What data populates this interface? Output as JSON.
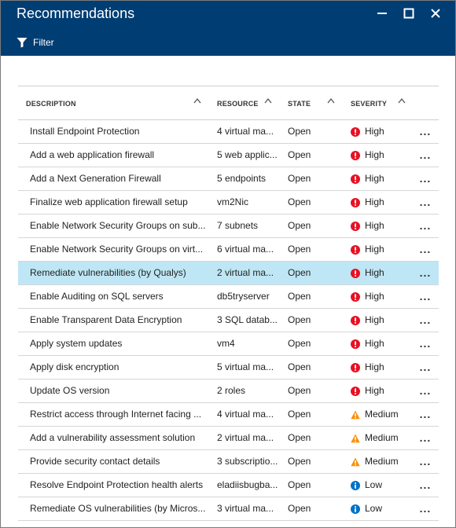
{
  "window": {
    "title": "Recommendations",
    "filter_label": "Filter"
  },
  "columns": {
    "description": "DESCRIPTION",
    "resource": "RESOURCE",
    "state": "STATE",
    "severity": "SEVERITY"
  },
  "colors": {
    "header_bg": "#003d73",
    "selected_row": "#bfe6f5",
    "high": "#e81123",
    "medium": "#ff8c00",
    "low": "#0072c6"
  },
  "rows": [
    {
      "description": "Install Endpoint Protection",
      "resource": "4 virtual ma...",
      "state": "Open",
      "severity": "High",
      "more": "...",
      "selected": false
    },
    {
      "description": "Add a web application firewall",
      "resource": "5 web applic...",
      "state": "Open",
      "severity": "High",
      "more": "...",
      "selected": false
    },
    {
      "description": "Add a Next Generation Firewall",
      "resource": "5 endpoints",
      "state": "Open",
      "severity": "High",
      "more": "...",
      "selected": false
    },
    {
      "description": "Finalize web application firewall setup",
      "resource": "vm2Nic",
      "state": "Open",
      "severity": "High",
      "more": "...",
      "selected": false
    },
    {
      "description": "Enable Network Security Groups on sub...",
      "resource": "7 subnets",
      "state": "Open",
      "severity": "High",
      "more": "...",
      "selected": false
    },
    {
      "description": "Enable Network Security Groups on virt...",
      "resource": "6 virtual ma...",
      "state": "Open",
      "severity": "High",
      "more": "...",
      "selected": false
    },
    {
      "description": "Remediate vulnerabilities (by Qualys)",
      "resource": "2 virtual ma...",
      "state": "Open",
      "severity": "High",
      "more": "...",
      "selected": true
    },
    {
      "description": "Enable Auditing on SQL servers",
      "resource": "db5tryserver",
      "state": "Open",
      "severity": "High",
      "more": "...",
      "selected": false
    },
    {
      "description": "Enable Transparent Data Encryption",
      "resource": "3 SQL datab...",
      "state": "Open",
      "severity": "High",
      "more": "...",
      "selected": false
    },
    {
      "description": "Apply system updates",
      "resource": "vm4",
      "state": "Open",
      "severity": "High",
      "more": "...",
      "selected": false
    },
    {
      "description": "Apply disk encryption",
      "resource": "5 virtual ma...",
      "state": "Open",
      "severity": "High",
      "more": "...",
      "selected": false
    },
    {
      "description": "Update OS version",
      "resource": "2 roles",
      "state": "Open",
      "severity": "High",
      "more": "...",
      "selected": false
    },
    {
      "description": "Restrict access through Internet facing ...",
      "resource": "4 virtual ma...",
      "state": "Open",
      "severity": "Medium",
      "more": "...",
      "selected": false
    },
    {
      "description": "Add a vulnerability assessment solution",
      "resource": "2 virtual ma...",
      "state": "Open",
      "severity": "Medium",
      "more": "...",
      "selected": false
    },
    {
      "description": "Provide security contact details",
      "resource": "3 subscriptio...",
      "state": "Open",
      "severity": "Medium",
      "more": "...",
      "selected": false
    },
    {
      "description": "Resolve Endpoint Protection health alerts",
      "resource": "eladiisbugba...",
      "state": "Open",
      "severity": "Low",
      "more": "...",
      "selected": false
    },
    {
      "description": "Remediate OS vulnerabilities (by Micros...",
      "resource": "3 virtual ma...",
      "state": "Open",
      "severity": "Low",
      "more": "...",
      "selected": false
    }
  ]
}
